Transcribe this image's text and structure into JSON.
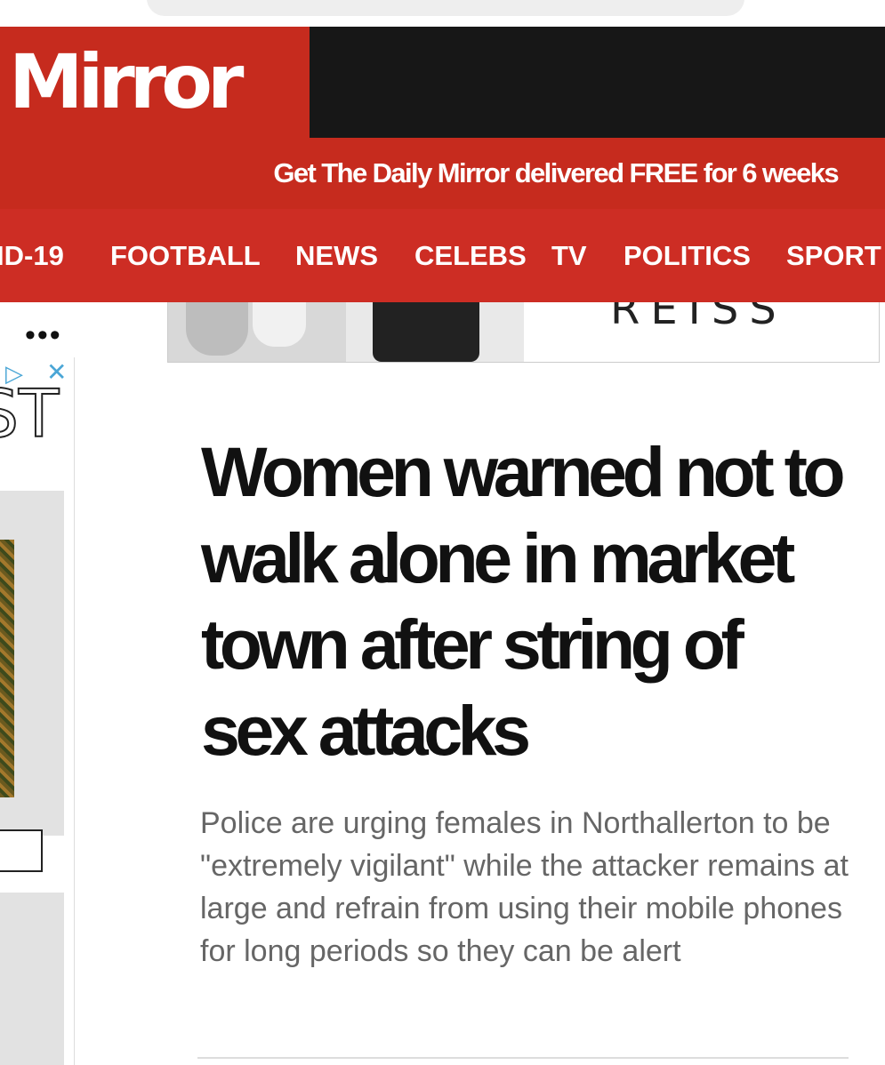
{
  "header": {
    "logo": "Mirror",
    "promo": "Get The Daily Mirror delivered FREE for 6 weeks"
  },
  "nav": {
    "items": [
      "ID-19",
      "FOOTBALL",
      "NEWS",
      "CELEBS",
      "TV",
      "POLITICS",
      "SPORT"
    ]
  },
  "ad_banner": {
    "brand": "REISS"
  },
  "side_ad": {
    "menu": "•••",
    "adchoice_icon": "ad-choices-icon",
    "close_icon": "close-icon",
    "partial_text": "ST"
  },
  "article": {
    "headline": "Women warned not to walk alone in market town after string of sex attacks",
    "standfirst": "Police are urging females in Northallerton to be \"extremely vigilant\" while the attacker remains at large and refrain from using their mobile phones for long periods so they can be alert"
  },
  "colors": {
    "brand_red": "#c62b1e",
    "nav_red": "#cd2d24",
    "header_black": "#171717"
  }
}
